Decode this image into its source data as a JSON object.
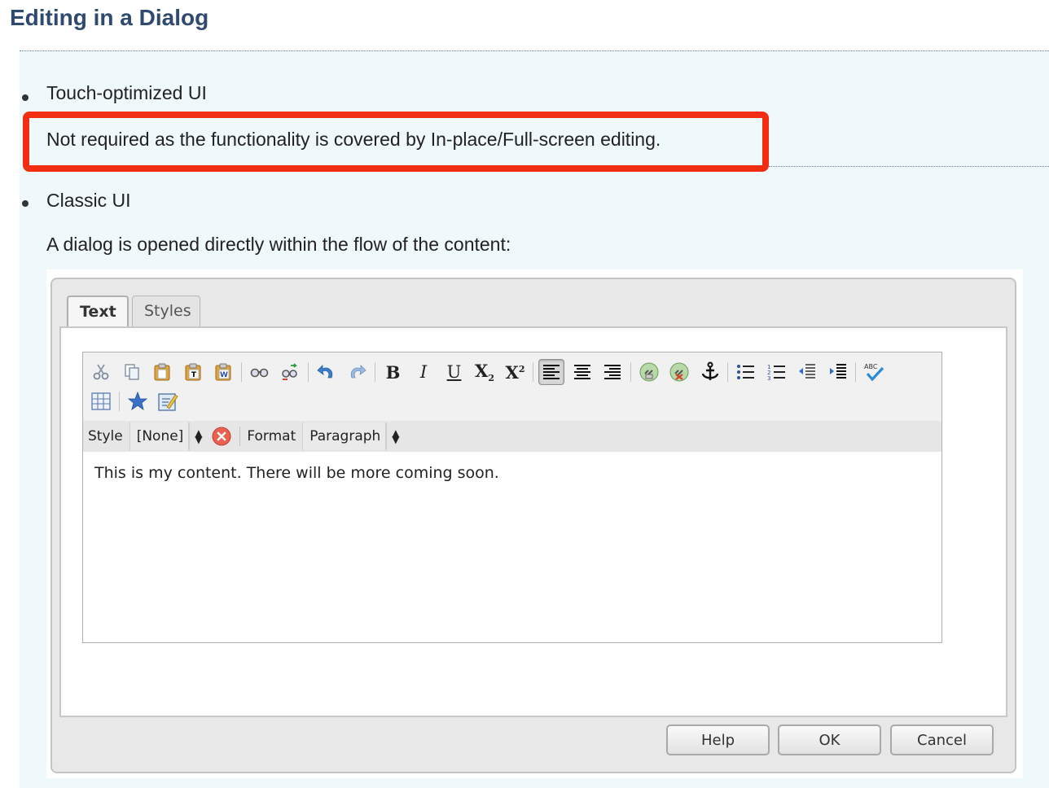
{
  "page": {
    "title": "Editing in a Dialog"
  },
  "touch": {
    "heading": "Touch-optimized UI",
    "note": "Not required as the functionality is covered by In-place/Full-screen editing."
  },
  "classic": {
    "heading": "Classic UI",
    "description": "A dialog is opened directly within the flow of the content:"
  },
  "dialog": {
    "tabs": [
      {
        "label": "Text",
        "active": true
      },
      {
        "label": "Styles",
        "active": false
      }
    ],
    "toolbar": {
      "row1": [
        {
          "name": "cut-icon"
        },
        {
          "name": "copy-icon"
        },
        {
          "name": "paste-icon"
        },
        {
          "name": "paste-plain-text-icon"
        },
        {
          "name": "paste-word-icon"
        },
        {
          "sep": true
        },
        {
          "name": "find-icon"
        },
        {
          "name": "replace-icon"
        },
        {
          "sep": true
        },
        {
          "name": "undo-icon"
        },
        {
          "name": "redo-icon"
        },
        {
          "sep": true
        },
        {
          "name": "bold-icon",
          "glyph": "B"
        },
        {
          "name": "italic-icon",
          "glyph": "I"
        },
        {
          "name": "underline-icon",
          "glyph": "U"
        },
        {
          "name": "subscript-icon",
          "glyph": "X"
        },
        {
          "name": "superscript-icon",
          "glyph": "X"
        },
        {
          "sep": true
        },
        {
          "name": "align-left-icon",
          "active": true
        },
        {
          "name": "align-center-icon"
        },
        {
          "name": "align-right-icon"
        },
        {
          "sep": true
        },
        {
          "name": "link-icon"
        },
        {
          "name": "unlink-icon"
        },
        {
          "name": "anchor-icon"
        },
        {
          "sep": true
        },
        {
          "name": "bullet-list-icon"
        },
        {
          "name": "numbered-list-icon"
        },
        {
          "name": "outdent-icon"
        },
        {
          "name": "indent-icon"
        },
        {
          "sep": true
        },
        {
          "name": "spellcheck-icon"
        }
      ],
      "row2": [
        {
          "name": "table-icon"
        },
        {
          "sep": true
        },
        {
          "name": "special-chars-icon"
        },
        {
          "name": "edit-source-icon"
        }
      ]
    },
    "style_label": "Style",
    "style_value": "[None]",
    "format_label": "Format",
    "format_value": "Paragraph",
    "content": "This is my content. There will be more coming soon.",
    "buttons": {
      "help": "Help",
      "ok": "OK",
      "cancel": "Cancel"
    }
  },
  "colors": {
    "title": "#2f4a6e",
    "panel_bg": "#eff8fb",
    "highlight_border": "#f32d11"
  }
}
